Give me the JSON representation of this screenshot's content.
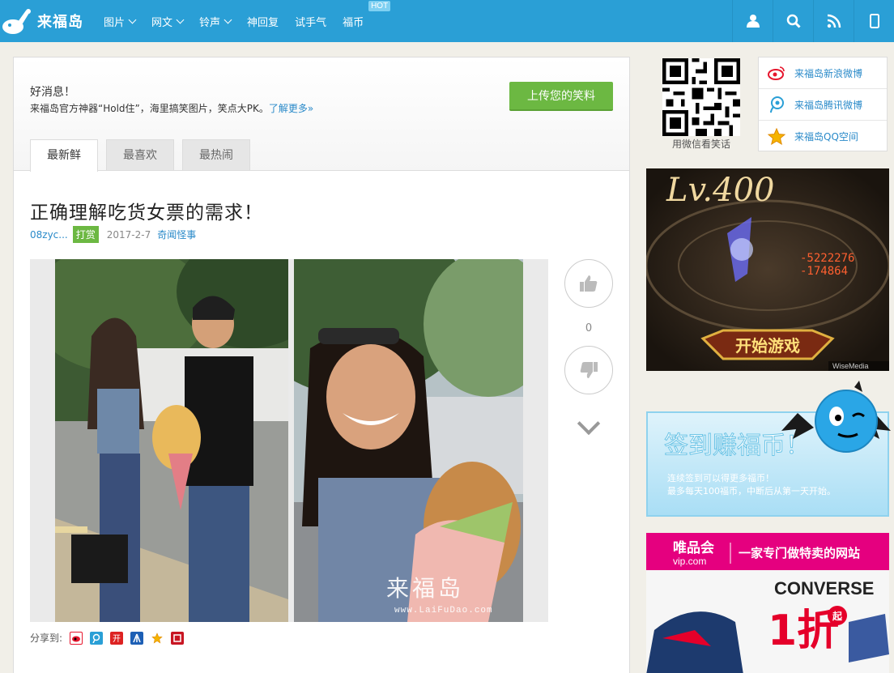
{
  "nav": {
    "logo_text": "来福岛",
    "menu": [
      {
        "label": "图片",
        "dropdown": true
      },
      {
        "label": "网文",
        "dropdown": true
      },
      {
        "label": "铃声",
        "dropdown": true
      },
      {
        "label": "神回复",
        "dropdown": false
      },
      {
        "label": "试手气",
        "dropdown": false
      },
      {
        "label": "福币",
        "dropdown": false,
        "badge": "HOT"
      }
    ],
    "icons": [
      "user-icon",
      "search-icon",
      "rss-icon",
      "mobile-icon"
    ]
  },
  "notice": {
    "title": "好消息！",
    "text": "来福岛官方神器“Hold住”，海里搞笑图片，笑点大PK。",
    "link": "了解更多»",
    "upload_button": "上传您的笑料"
  },
  "tabs": [
    "最新鲜",
    "最喜欢",
    "最热闹"
  ],
  "post": {
    "title": "正确理解吃货女票的需求！",
    "author": "08zyc...",
    "tip_label": "打赏",
    "date": "2017-2-7",
    "category": "奇闻怪事",
    "watermark": "来福岛",
    "watermark_url": "www.LaiFuDao.com",
    "vote_count": "0"
  },
  "share": {
    "label": "分享到:",
    "targets": [
      {
        "name": "sina-weibo",
        "color": "#e6162d"
      },
      {
        "name": "tencent-weibo",
        "color": "#2a9fd6"
      },
      {
        "name": "kaixin",
        "color": "#d22"
      },
      {
        "name": "renren",
        "color": "#1d5fb5"
      },
      {
        "name": "qzone",
        "color": "#f5b400"
      },
      {
        "name": "netease",
        "color": "#c81623"
      }
    ]
  },
  "sidebar": {
    "qr_caption": "用微信看笑话",
    "social": [
      "来福岛新浪微博",
      "来福岛腾讯微博",
      "来福岛QQ空间"
    ],
    "ad_game": {
      "top_text": "Lv.400",
      "button": "开始游戏",
      "credit": "WiseMedia"
    },
    "ad_sign": {
      "title": "签到赚福币！",
      "line1": "连续签到可以得更多福币！",
      "line2": "最多每天100福币，中断后从第一天开始。"
    },
    "ad_vip": {
      "brand": "唯品会",
      "domain": "vip.com",
      "slogan": "一家专门做特卖的网站",
      "product": "CONVERSE",
      "discount": "1折",
      "suffix": "起"
    }
  },
  "colors": {
    "nav": "#2a9fd6",
    "accent_green": "#6cb842",
    "link": "#2a8ac9"
  }
}
